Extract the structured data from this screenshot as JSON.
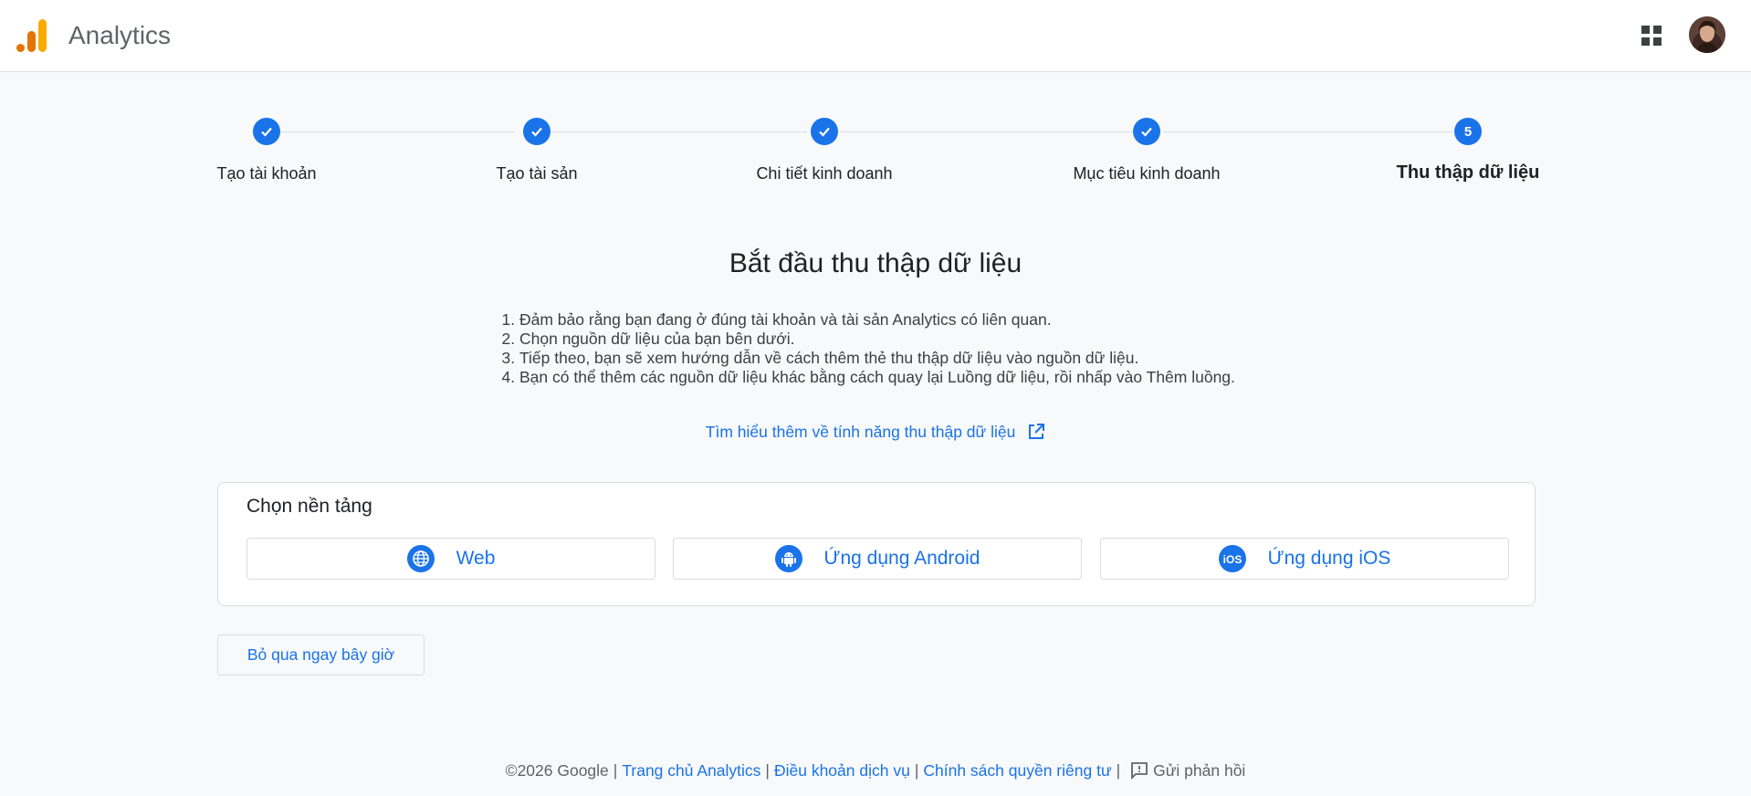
{
  "header": {
    "app_title": "Analytics",
    "apps_icon": "apps-grid-icon",
    "avatar": "user-avatar"
  },
  "colors": {
    "accent": "#1a73e8",
    "logo_dark": "#e37400",
    "logo_light": "#f9ab00"
  },
  "stepper": {
    "steps": [
      {
        "label": "Tạo tài khoản",
        "state": "done"
      },
      {
        "label": "Tạo tài sản",
        "state": "done"
      },
      {
        "label": "Chi tiết kinh doanh",
        "state": "done"
      },
      {
        "label": "Mục tiêu kinh doanh",
        "state": "done"
      },
      {
        "label": "Thu thập dữ liệu",
        "state": "active",
        "number": "5"
      }
    ]
  },
  "main": {
    "title": "Bắt đầu thu thập dữ liệu",
    "instructions": [
      "Đảm bảo rằng bạn đang ở đúng tài khoản và tài sản Analytics có liên quan.",
      "Chọn nguồn dữ liệu của bạn bên dưới.",
      "Tiếp theo, bạn sẽ xem hướng dẫn về cách thêm thẻ thu thập dữ liệu vào nguồn dữ liệu.",
      "Bạn có thể thêm các nguồn dữ liệu khác bằng cách quay lại Luồng dữ liệu, rồi nhấp vào Thêm luồng."
    ],
    "learn_more": "Tìm hiểu thêm về tính năng thu thập dữ liệu"
  },
  "platform": {
    "heading": "Chọn nền tảng",
    "options": [
      {
        "label": "Web",
        "icon": "globe-icon"
      },
      {
        "label": "Ứng dụng Android",
        "icon": "android-icon"
      },
      {
        "label": "Ứng dụng iOS",
        "icon": "ios-icon"
      }
    ]
  },
  "skip_button": "Bỏ qua ngay bây giờ",
  "footer": {
    "copyright": "©2026 Google",
    "links": [
      "Trang chủ Analytics",
      "Điều khoản dịch vụ",
      "Chính sách quyền riêng tư"
    ],
    "feedback": "Gửi phản hồi"
  }
}
